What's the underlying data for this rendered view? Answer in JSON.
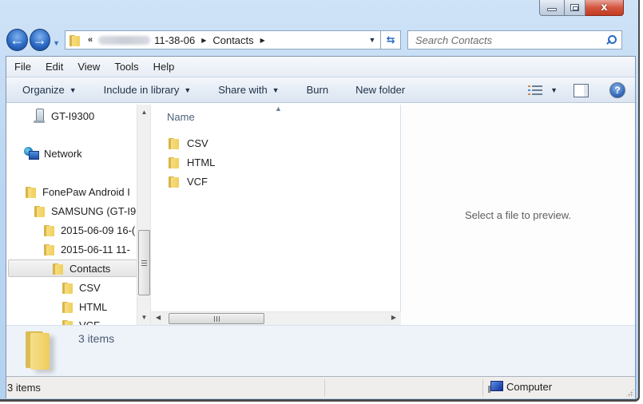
{
  "window": {
    "caption_buttons": {
      "minimize": "minimize-icon",
      "maximize": "maximize-icon",
      "close": "close-icon",
      "close_glyph": "x"
    }
  },
  "nav": {
    "back_glyph": "←",
    "forward_glyph": "→",
    "history_caret": "▼",
    "address": {
      "overflow_chevron": "«",
      "crumbs": [
        "11-38-06",
        "Contacts"
      ],
      "crumb_separator": "▶",
      "dropdown_caret": "▼",
      "refresh_glyph": "⇆"
    },
    "search": {
      "placeholder": "Search Contacts",
      "value": ""
    }
  },
  "menubar": {
    "items": [
      "File",
      "Edit",
      "View",
      "Tools",
      "Help"
    ]
  },
  "toolbar": {
    "organize": "Organize",
    "include_in_library": "Include in library",
    "share_with": "Share with",
    "burn": "Burn",
    "new_folder": "New folder",
    "caret": "▼",
    "help_glyph": "?"
  },
  "navigation_pane": {
    "items": [
      {
        "label": "GT-I9300",
        "icon": "phone-icon"
      },
      {
        "label": "Network",
        "icon": "network-icon"
      },
      {
        "label": "FonePaw Android I",
        "icon": "folder-icon"
      },
      {
        "label": "SAMSUNG (GT-I9",
        "icon": "folder-icon"
      },
      {
        "label": "2015-06-09 16-(",
        "icon": "folder-icon"
      },
      {
        "label": "2015-06-11 11-",
        "icon": "folder-icon"
      },
      {
        "label": "Contacts",
        "icon": "folder-icon",
        "selected": true
      },
      {
        "label": "CSV",
        "icon": "folder-icon"
      },
      {
        "label": "HTML",
        "icon": "folder-icon"
      },
      {
        "label": "VCF",
        "icon": "folder-icon"
      }
    ],
    "scroll_up": "▲",
    "scroll_down": "▼"
  },
  "file_list": {
    "column_header": "Name",
    "sort_indicator": "▲",
    "items": [
      "CSV",
      "HTML",
      "VCF"
    ],
    "scroll_left": "◀",
    "scroll_right": "▶"
  },
  "preview": {
    "message": "Select a file to preview."
  },
  "details_pane": {
    "count": "3 items"
  },
  "statusbar": {
    "count": "3 items",
    "zone": "Computer"
  }
}
